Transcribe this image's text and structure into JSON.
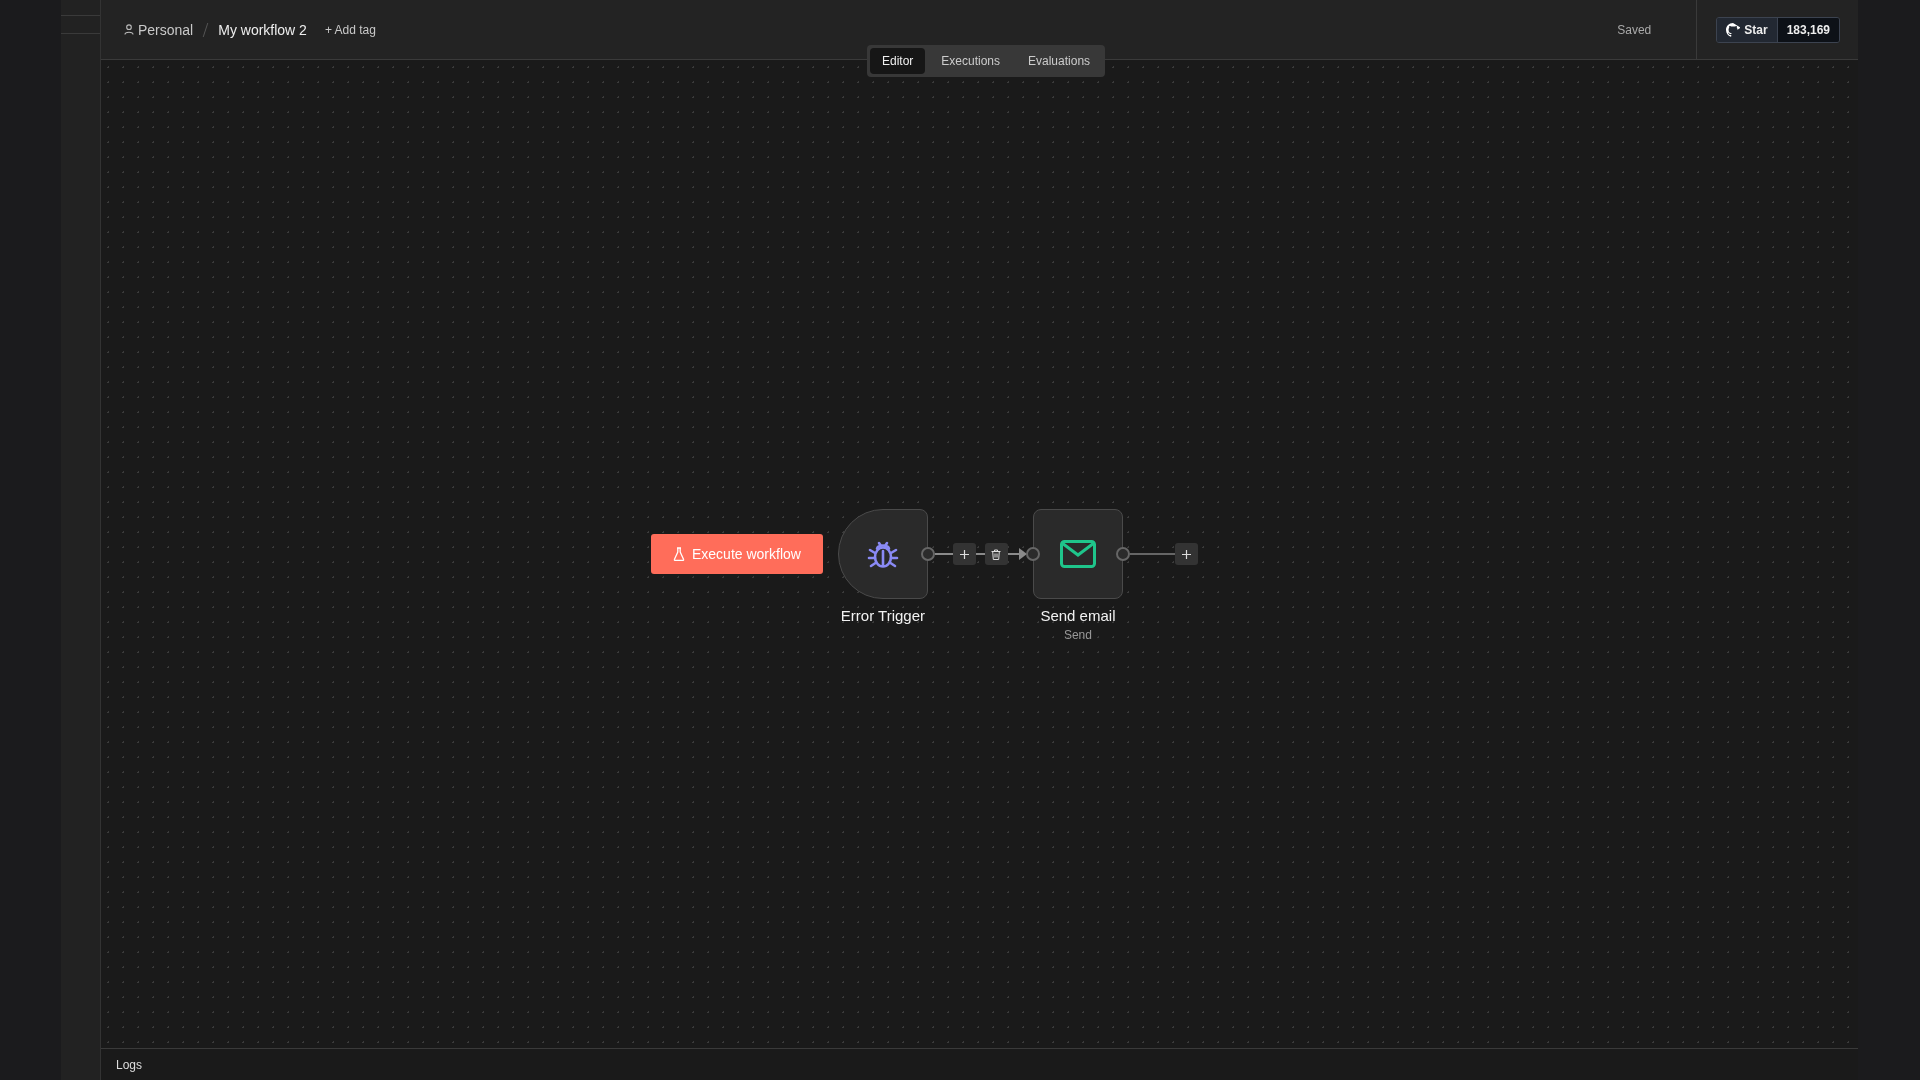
{
  "header": {
    "project": "Personal",
    "workflow_name": "My workflow 2",
    "add_tag": "+ Add tag",
    "status": "Saved",
    "github": {
      "label": "Star",
      "count": "183,169"
    }
  },
  "tabs": [
    {
      "label": "Editor",
      "selected": true
    },
    {
      "label": "Executions",
      "selected": false
    },
    {
      "label": "Evaluations",
      "selected": false
    }
  ],
  "canvas": {
    "execute_button": "Execute workflow",
    "nodes": [
      {
        "kind": "trigger",
        "name": "Error Trigger"
      },
      {
        "kind": "action",
        "name": "Send email",
        "subtitle": "Send"
      }
    ]
  },
  "logs": {
    "label": "Logs"
  }
}
